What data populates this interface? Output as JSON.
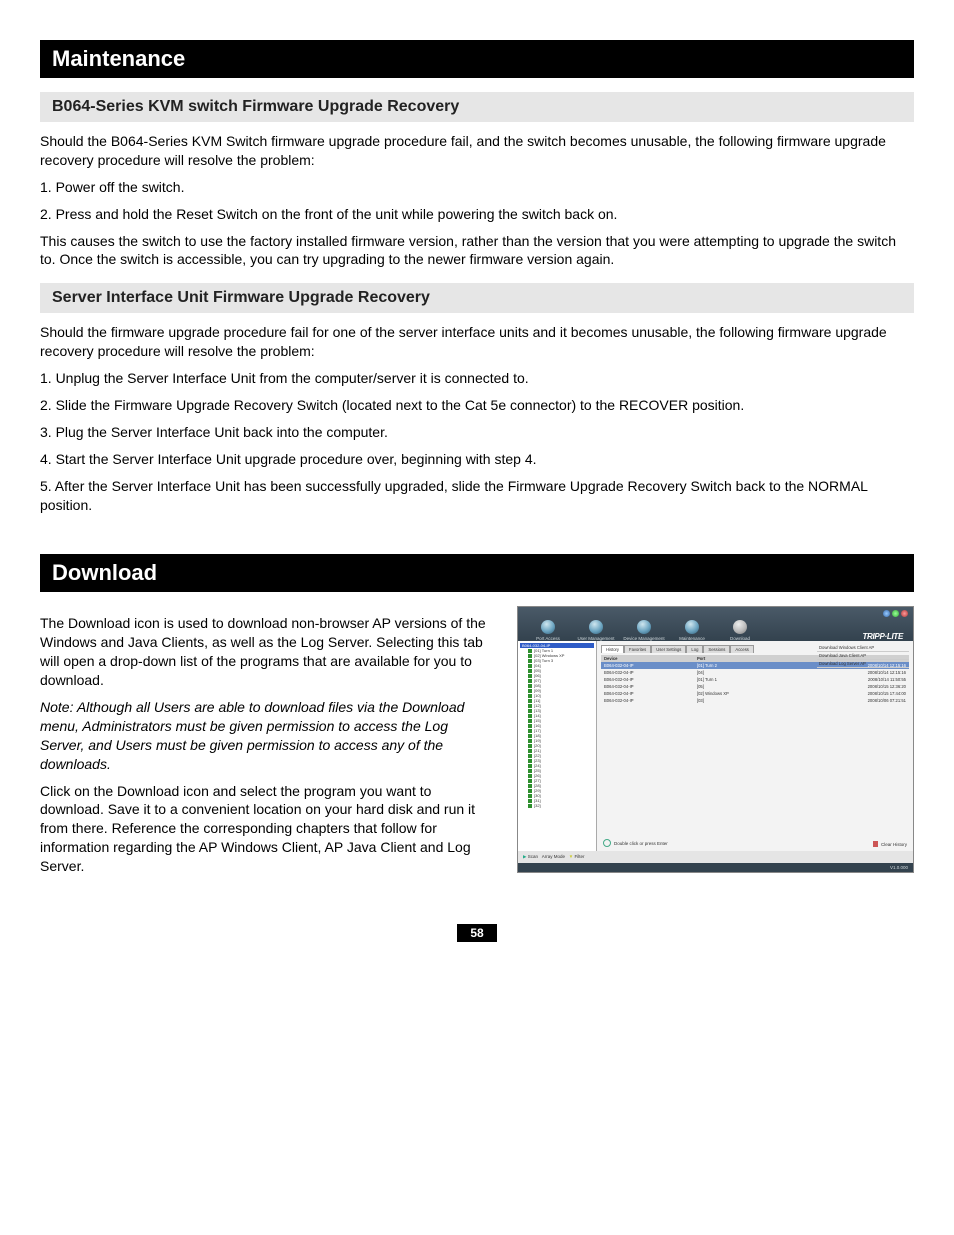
{
  "sections": {
    "maintenance": {
      "title": "Maintenance",
      "sub1": {
        "title": "B064-Series KVM switch Firmware Upgrade Recovery",
        "p1": "Should the B064-Series KVM Switch firmware upgrade procedure fail, and the switch becomes unusable, the following firmware upgrade recovery procedure will resolve the problem:",
        "l1": "1. Power off the switch.",
        "l2": "2. Press and hold the Reset Switch on the front of the unit while powering the switch back on.",
        "p2": "This causes the switch to use the factory installed firmware version, rather than the version that you were attempting to upgrade the switch to. Once the switch is accessible, you can try upgrading to the newer firmware version again."
      },
      "sub2": {
        "title": "Server Interface Unit Firmware Upgrade Recovery",
        "p1": "Should the firmware upgrade procedure fail for one of the server interface units and it becomes unusable, the following firmware upgrade recovery procedure will resolve the problem:",
        "l1": "1. Unplug the Server Interface Unit from the computer/server it is connected to.",
        "l2": "2. Slide the Firmware Upgrade Recovery Switch (located next to the Cat 5e connector) to the RECOVER position.",
        "l3": "3. Plug the Server Interface Unit back into the computer.",
        "l4": "4. Start the Server Interface Unit upgrade procedure over, beginning with step 4.",
        "l5": "5. After the Server Interface Unit has been successfully upgraded, slide the Firmware Upgrade Recovery Switch back to the NORMAL position."
      }
    },
    "download": {
      "title": "Download",
      "p1": "The Download icon is used to download non-browser AP versions of the Windows and Java Clients, as well as the Log Server. Selecting this tab will open a drop-down list of the programs that are available for you to download.",
      "note": "Note: Although all Users are able to download files via the Download menu, Administrators must be given permission to access the Log Server, and Users must be given permission to access any of the downloads.",
      "p2": "Click on the Download icon and select the program you want to download. Save it to a convenient location on your hard disk and run it from there. Reference the corresponding chapters that follow for information regarding the AP Windows Client, AP Java Client and Log Server."
    }
  },
  "screenshot": {
    "toolbar": {
      "items": [
        {
          "label": "Port Access"
        },
        {
          "label": "User Management"
        },
        {
          "label": "Device Management"
        },
        {
          "label": "Maintenance"
        },
        {
          "label": "Download"
        }
      ],
      "logo": "TRIPP·LITE"
    },
    "sidebar": {
      "root": "B064-032-04-IP",
      "items": [
        "[01] Turn 1",
        "[02] Windows XP",
        "[03] Turn 3"
      ],
      "ports": [
        "[04]",
        "[05]",
        "[06]",
        "[07]",
        "[08]",
        "[09]",
        "[10]",
        "[11]",
        "[12]",
        "[13]",
        "[14]",
        "[15]",
        "[16]",
        "[17]",
        "[18]",
        "[19]",
        "[20]",
        "[21]",
        "[22]",
        "[23]",
        "[24]",
        "[25]",
        "[26]",
        "[27]",
        "[28]",
        "[29]",
        "[30]",
        "[31]",
        "[32]"
      ]
    },
    "mainTabs": [
      "History",
      "Favorites",
      "User Settings",
      "Log",
      "Sessions",
      "Access"
    ],
    "rightMenu": [
      "Download Windows Client AP",
      "Download Java Client AP",
      "Download Log Server AP"
    ],
    "table": {
      "headers": [
        "Device",
        "Port",
        "",
        "",
        ""
      ],
      "rows": [
        {
          "c1": "B064-032-04-IP",
          "c2": "[01] Turn 2",
          "c3": "2008/10/14 12:15:16",
          "hi": true
        },
        {
          "c1": "B064-032-04-IP",
          "c2": "[04]",
          "c3": "2008/10/14 12:15:16"
        },
        {
          "c1": "B064-032-04-IP",
          "c2": "[01] Turn 1",
          "c3": "2008/10/14 11:50:55"
        },
        {
          "c1": "B064-032-04-IP",
          "c2": "[05]",
          "c3": "2008/10/15 12:36:20"
        },
        {
          "c1": "B064-032-04-IP",
          "c2": "[02] Windows XP",
          "c3": "2008/10/15 17:44:00"
        },
        {
          "c1": "B064-032-04-IP",
          "c2": "[03]",
          "c3": "2008/10/06 07:21:51"
        }
      ]
    },
    "statusLeft": "Double click or press Enter",
    "statusRight": "Clear History",
    "bottomLeft1": "Scan",
    "bottomLeft2": "Array Mode",
    "bottomLeft3": "Filter",
    "version": "V1.0.000"
  },
  "pageNumber": "58"
}
